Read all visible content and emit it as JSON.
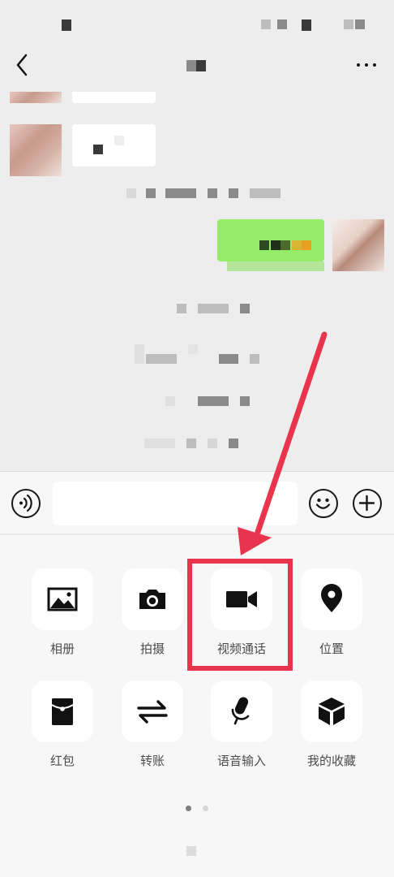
{
  "apps": {
    "album": {
      "label": "相册",
      "icon": "image-icon"
    },
    "camera": {
      "label": "拍摄",
      "icon": "camera-icon"
    },
    "video_call": {
      "label": "视频通话",
      "icon": "video-camera-icon"
    },
    "location": {
      "label": "位置",
      "icon": "location-pin-icon"
    },
    "red_packet": {
      "label": "红包",
      "icon": "red-packet-icon"
    },
    "transfer": {
      "label": "转账",
      "icon": "transfer-arrows-icon"
    },
    "voice_input": {
      "label": "语音输入",
      "icon": "microphone-icon"
    },
    "favorites": {
      "label": "我的收藏",
      "icon": "cube-icon"
    }
  },
  "input": {
    "value": "",
    "placeholder": ""
  },
  "colors": {
    "highlight": "#e8344c",
    "sent_bubble": "#95ec69",
    "background": "#ededed",
    "panel": "#f7f7f7"
  },
  "pager": {
    "pages": 2,
    "active": 1
  }
}
